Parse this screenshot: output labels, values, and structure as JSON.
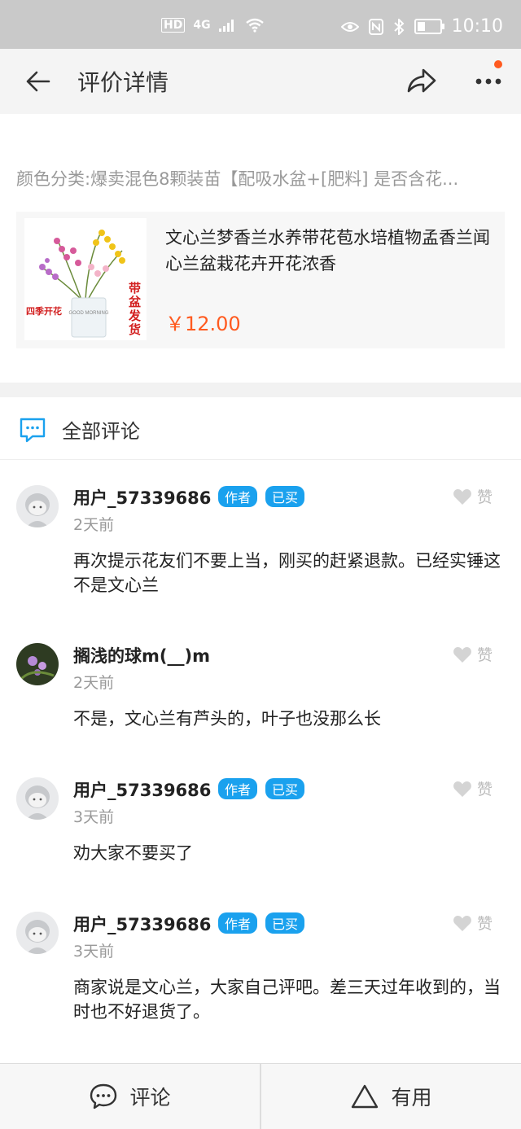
{
  "status_bar": {
    "network": "HD",
    "signal": "4G",
    "time": "10:10",
    "battery_level": 0.35
  },
  "header": {
    "title": "评价详情"
  },
  "product": {
    "spec": "颜色分类:爆卖混色8颗装苗【配吸水盆+[肥料] 是否含花...",
    "title": "文心兰梦香兰水养带花苞水培植物孟香兰闻心兰盆栽花卉开花浓香",
    "price": "￥12.00",
    "image_text_left": "四季开花",
    "image_text_right": "带盆发货",
    "image_text_pot": "GOOD MORNING"
  },
  "comments_section": {
    "title": "全部评论"
  },
  "comments": [
    {
      "name": "用户_57339686",
      "badges": [
        "作者",
        "已买"
      ],
      "time": "2天前",
      "text": "再次提示花友们不要上当，刚买的赶紧退款。已经实锤这不是文心兰",
      "like_label": "赞"
    },
    {
      "name": "搁浅的球m(__)m",
      "badges": [],
      "time": "2天前",
      "text": "不是，文心兰有芦头的，叶子也没那么长",
      "like_label": "赞"
    },
    {
      "name": "用户_57339686",
      "badges": [
        "作者",
        "已买"
      ],
      "time": "3天前",
      "text": "劝大家不要买了",
      "like_label": "赞"
    },
    {
      "name": "用户_57339686",
      "badges": [
        "作者",
        "已买"
      ],
      "time": "3天前",
      "text": "商家说是文心兰，大家自己评吧。差三天过年收到的，当时也不好退货了。",
      "like_label": "赞"
    }
  ],
  "bottom_bar": {
    "comment_label": "评论",
    "useful_label": "有用"
  },
  "colors": {
    "accent_orange": "#ff5a1f",
    "badge_blue": "#1aa1ee"
  }
}
